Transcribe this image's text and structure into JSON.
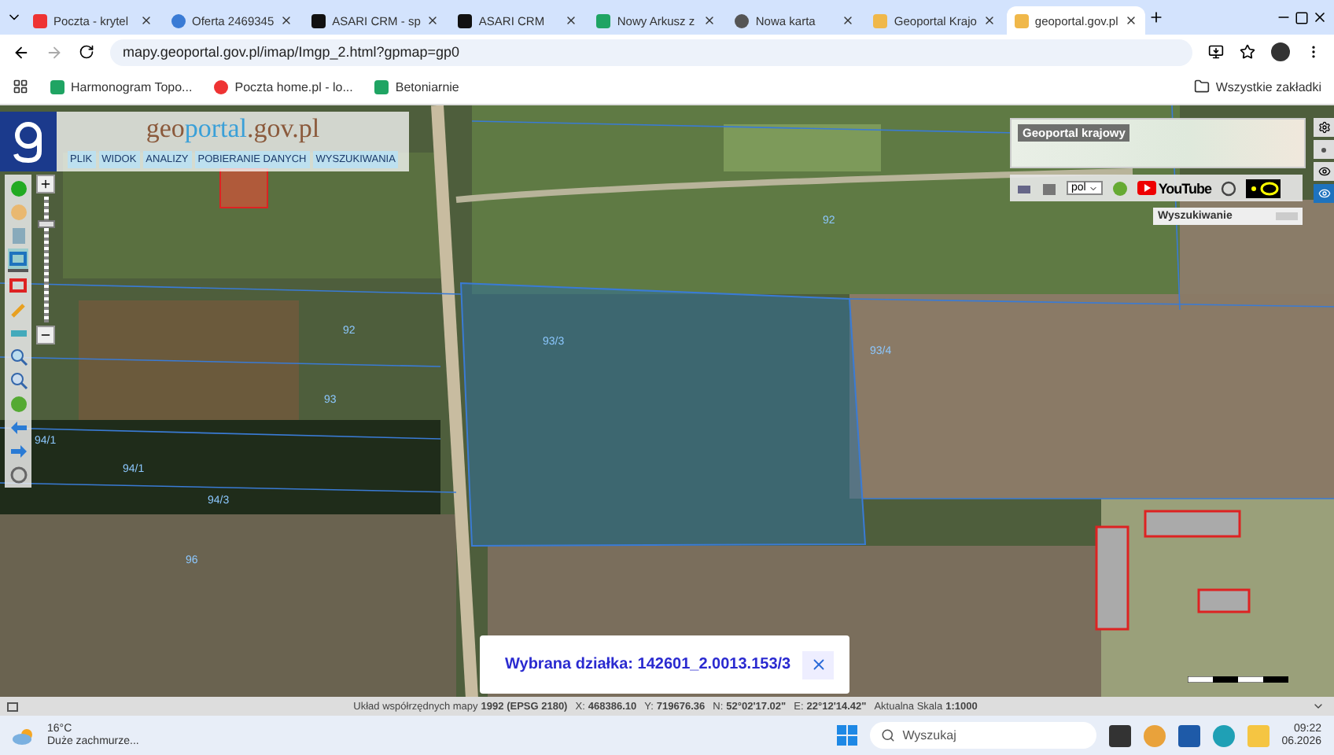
{
  "browser": {
    "tabs": [
      {
        "label": "Poczta - krytel",
        "selected": false,
        "kind": "mail"
      },
      {
        "label": "Oferta 2469345",
        "selected": false,
        "kind": "search"
      },
      {
        "label": "ASARI CRM - sp",
        "selected": false,
        "kind": "crm"
      },
      {
        "label": "ASARI CRM",
        "selected": false,
        "kind": "crm"
      },
      {
        "label": "Nowy Arkusz z",
        "selected": false,
        "kind": "sheet"
      },
      {
        "label": "Nowa karta",
        "selected": false,
        "kind": "chrome"
      },
      {
        "label": "Geoportal Krajo",
        "selected": false,
        "kind": "geo"
      },
      {
        "label": "geoportal.gov.pl",
        "selected": true,
        "kind": "geo"
      }
    ],
    "address": "mapy.geoportal.gov.pl/imap/Imgp_2.html?gpmap=gp0",
    "bookmarks": [
      {
        "label": "Harmonogram Topo...",
        "kind": "sheet"
      },
      {
        "label": "Poczta home.pl - lo...",
        "kind": "mail"
      },
      {
        "label": "Betoniarnie",
        "kind": "sheet"
      }
    ],
    "all_bookmarks": "Wszystkie zakładki"
  },
  "geoportal": {
    "logo_parts": [
      "geo",
      "portal",
      ".gov.pl"
    ],
    "menu": [
      "PLIK",
      "WIDOK",
      "ANALIZY",
      "POBIERANIE DANYCH",
      "WYSZUKIWANIA"
    ],
    "tools": [
      {
        "kind": "info",
        "selected": false
      },
      {
        "kind": "pan",
        "selected": false
      },
      {
        "kind": "legend",
        "selected": false
      },
      {
        "kind": "select",
        "selected": true
      },
      {
        "kind": "select-red",
        "selected": false
      },
      {
        "kind": "pencil",
        "selected": false
      },
      {
        "kind": "ruler",
        "selected": false
      },
      {
        "kind": "zoom-in",
        "selected": false
      },
      {
        "kind": "zoom-out",
        "selected": false
      },
      {
        "kind": "globe",
        "selected": false
      },
      {
        "kind": "back",
        "selected": false
      },
      {
        "kind": "forward",
        "selected": false
      },
      {
        "kind": "target",
        "selected": false
      }
    ],
    "zoom": {
      "level": 0.8
    },
    "overview_title": "Geoportal krajowy",
    "language": "pol",
    "youtube": "YouTube",
    "search_panel": "Wyszukiwanie",
    "parcel_labels": [
      "92",
      "93/3",
      "93/4",
      "92",
      "93",
      "94/1",
      "94/1",
      "94/3",
      "96"
    ],
    "popup": {
      "text": "Wybrana działka: 142601_2.0013.153/3"
    },
    "status": {
      "items": [
        {
          "label": "Układ współrzędnych mapy",
          "value": "1992 (EPSG 2180)"
        },
        {
          "label": "X:",
          "value": "468386.10"
        },
        {
          "label": "Y:",
          "value": "719676.36"
        },
        {
          "label": "N:",
          "value": "52°02'17.02\""
        },
        {
          "label": "E:",
          "value": "22°12'14.42\""
        },
        {
          "label": "Aktualna Skala",
          "value": "1:1000"
        }
      ]
    }
  },
  "taskbar": {
    "temperature": "16°C",
    "weather": "Duże zachmurze...",
    "search_placeholder": "Wyszukaj",
    "time": "09:22",
    "date": "06.2026"
  }
}
